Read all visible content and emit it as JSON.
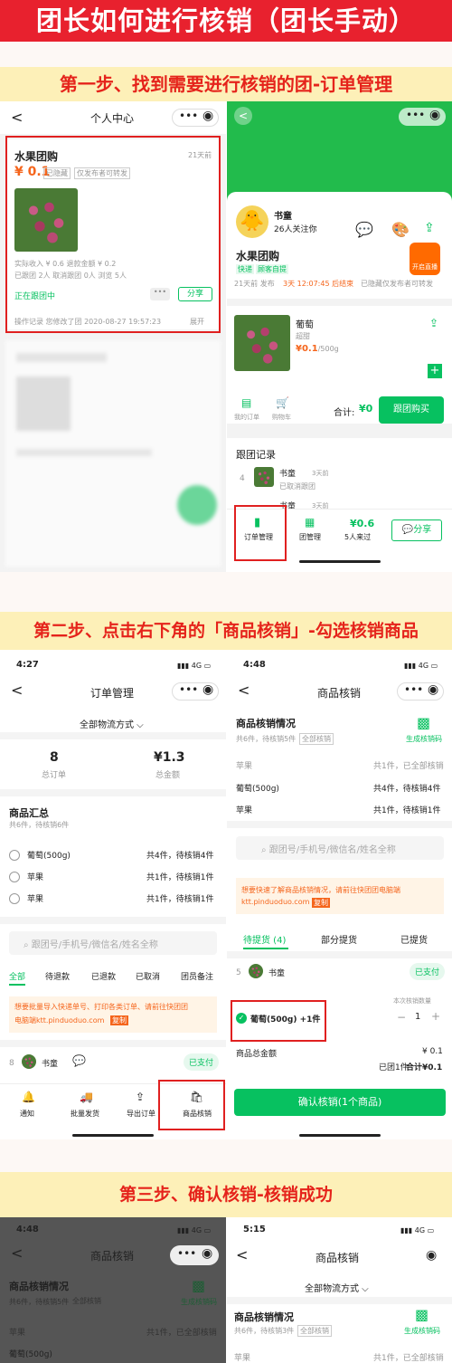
{
  "banner": "团长如何进行核销（团长手动）",
  "steps": {
    "s1": "第一步、找到需要进行核销的团-订单管理",
    "s2": "第二步、点击右下角的「商品核销」-勾选核销商品",
    "s3": "第三步、确认核销-核销成功"
  },
  "p1l": {
    "title": "个人中心",
    "group": "水果团购",
    "days": "21天前",
    "price": "¥ 0.1",
    "tag1": "已隐藏",
    "tag2": "仅发布者可转发",
    "stat1": "实际收入 ¥ 0.6   退款金额 ¥ 0.2",
    "stat2": "已跟团 2人   取消跟团 0人   浏览 5人",
    "status": "正在跟团中",
    "share": "分享",
    "log": "操作记录 您修改了团 2020-08-27 19:57:23",
    "expand": "展开"
  },
  "p1r": {
    "name": "书童",
    "follow": "26人关注你",
    "live": "开启直播",
    "group": "水果团购",
    "tag1": "快递",
    "tag2": "顾客自提",
    "meta": "21天前 发布",
    "countdown": "3天 12:07:45 后结束",
    "hidden": "已隐藏仅发布者可转发",
    "product": "葡萄",
    "sub": "超甜",
    "price": "¥0.1",
    "unit": "/500g",
    "my_orders": "我的订单",
    "cart": "购物车",
    "total_label": "合计:",
    "total": "¥0",
    "buy": "跟团购买",
    "rec_title": "跟团记录",
    "rec_no": "4",
    "rec_name": "书童",
    "rec_time": "3天前",
    "rec_status": "已取消跟团",
    "rec2_name": "书童",
    "rec2_time": "3天前",
    "nav1": "订单管理",
    "nav2": "团管理",
    "views": "¥0.6",
    "views_label": "5人来过",
    "share": "分享"
  },
  "p2l": {
    "time": "4:27",
    "net": "4G",
    "title": "订单管理",
    "filter": "全部物流方式",
    "orders": "8",
    "orders_label": "总订单",
    "amount": "¥1.3",
    "amount_label": "总金额",
    "summary": "商品汇总",
    "summary_sub": "共6件，待核销6件",
    "items": [
      {
        "name": "葡萄(500g)",
        "count": "共4件，待核销4件"
      },
      {
        "name": "苹果",
        "count": "共1件，待核销1件"
      },
      {
        "name": "苹果",
        "count": "共1件，待核销1件"
      }
    ],
    "search": "跟团号/手机号/微信名/姓名全称",
    "tabs": [
      "全部",
      "待退款",
      "已退款",
      "已取消",
      "团员备注"
    ],
    "notice1": "想要批量导入快递单号、打印各类订单、请前往快团团",
    "notice2": "电脑端ktt.pinduoduo.com",
    "copy": "复制",
    "order_no": "8",
    "order_name": "书童",
    "paid": "已支付",
    "bnav": [
      "通知",
      "批量发货",
      "导出订单",
      "商品核销"
    ]
  },
  "p2r": {
    "time": "4:48",
    "net": "4G",
    "title": "商品核销",
    "info": "商品核销情况",
    "info_sub": "共6件，待核销5件",
    "all": "全部核销",
    "qr": "生成核销码",
    "rows": [
      {
        "name": "苹果",
        "count": "共1件，已全部核销"
      },
      {
        "name": "葡萄(500g)",
        "count": "共4件，待核销4件"
      },
      {
        "name": "苹果",
        "count": "共1件，待核销1件"
      }
    ],
    "search": "跟团号/手机号/微信名/姓名全称",
    "notice1": "想要快速了解商品核销情况，请前往快团团电脑端",
    "notice2": "ktt.pinduoduo.com",
    "copy": "复制",
    "tabs": [
      "待提货 (4)",
      "部分提货",
      "已提货"
    ],
    "order_no": "5",
    "order_name": "书童",
    "paid": "已支付",
    "qty_label": "本次核销数量",
    "check_item": "葡萄(500g) +1件",
    "qty": "1",
    "total_label": "商品总金额",
    "total": "¥ 0.1",
    "followed": "已团1件",
    "sum": "合计¥0.1",
    "confirm": "确认核销(1个商品)"
  },
  "p3l": {
    "time": "4:48",
    "title": "商品核销",
    "info": "商品核销情况",
    "info_sub": "共6件，待核销5件",
    "all": "全部核销",
    "qr": "生成核销码",
    "row1": "苹果",
    "row1c": "共1件，已全部核销",
    "row2": "葡萄(500g)"
  },
  "p3r": {
    "time": "5:15",
    "net": "4G",
    "title": "商品核销",
    "filter": "全部物流方式",
    "info": "商品核销情况",
    "info_sub": "共6件，待核销3件",
    "all": "全部核销",
    "qr": "生成核销码",
    "row1": "苹果",
    "row1c": "共1件，已全部核销"
  }
}
